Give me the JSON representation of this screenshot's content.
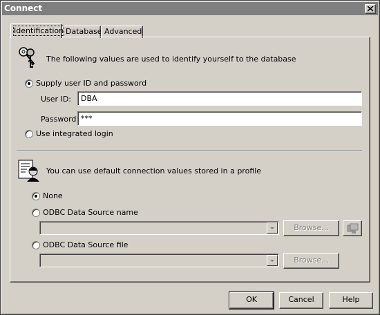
{
  "window": {
    "title": "Connect"
  },
  "tabs": [
    {
      "label": "Identification"
    },
    {
      "label": "Database"
    },
    {
      "label": "Advanced"
    }
  ],
  "identification": {
    "intro_text": "The following values are used to identify yourself to the database",
    "supply_option": "Supply user ID and password",
    "user_id_label": "User ID:",
    "user_id_value": "DBA",
    "password_label": "Password:",
    "password_value": "***",
    "integrated_option": "Use integrated login",
    "selected": "supply"
  },
  "profile": {
    "intro_text": "You can use default connection values stored in a profile",
    "none_option": "None",
    "dsn_option": "ODBC Data Source name",
    "dsn_value": "",
    "dsn_browse": "Browse...",
    "file_option": "ODBC Data Source file",
    "file_value": "",
    "file_browse": "Browse...",
    "selected": "none"
  },
  "buttons": {
    "ok": "OK",
    "cancel": "Cancel",
    "help": "Help"
  },
  "icons": {
    "keys": "keys-icon",
    "profile": "profile-icon",
    "odbc_admin": "odbc-admin-icon",
    "close": "close-icon"
  }
}
